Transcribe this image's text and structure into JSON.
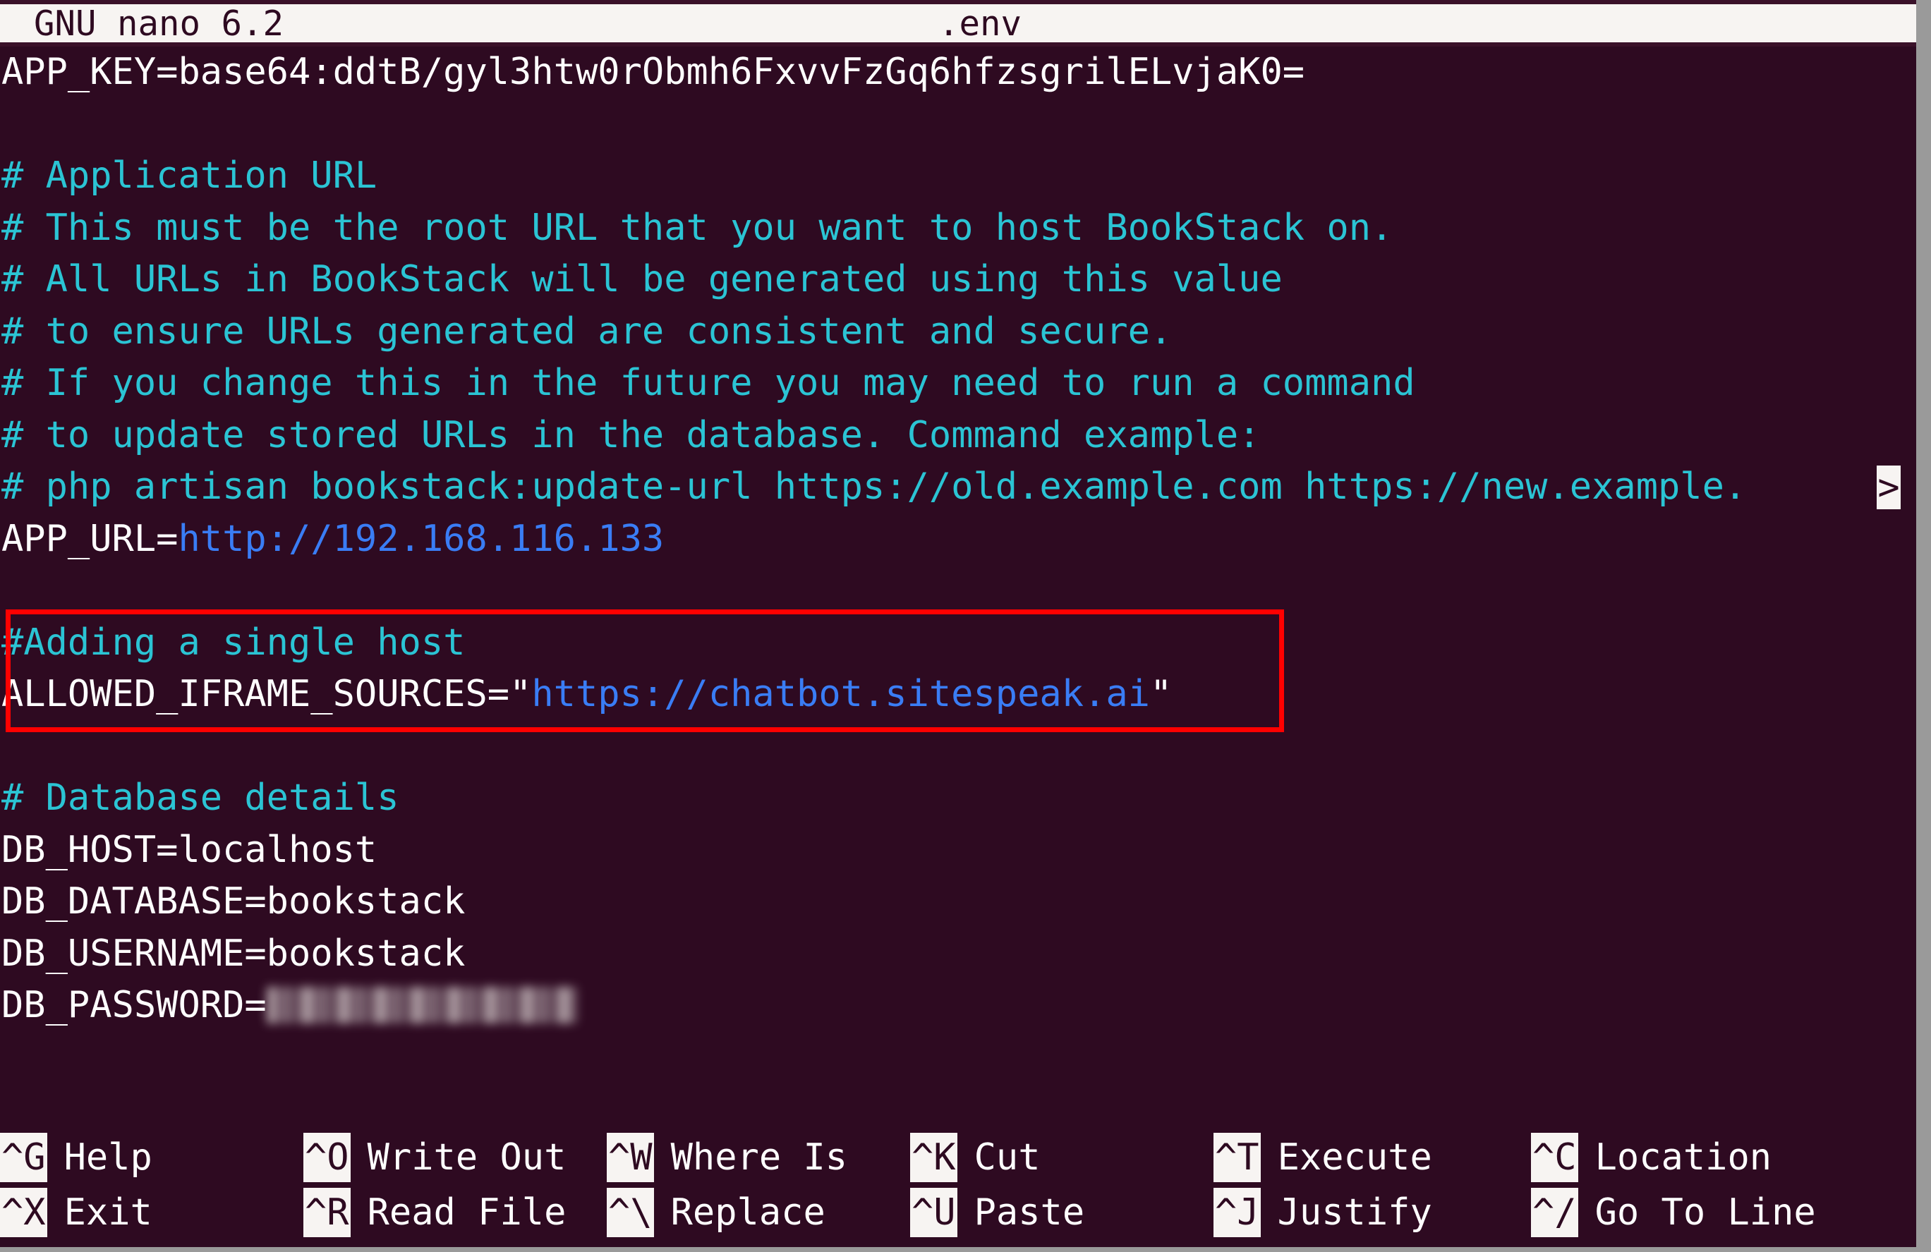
{
  "titlebar": {
    "app": "GNU nano 6.2",
    "filename": ".env"
  },
  "editor": {
    "lines": [
      {
        "id": "app-key",
        "segments": [
          {
            "text": "APP_KEY=base64:ddtB/gyl3htw0rObmh6FxvvFzGq6hfzsgrilELvjaK0=",
            "style": "plain"
          }
        ]
      },
      {
        "id": "blank-1",
        "segments": [
          {
            "text": " ",
            "style": "plain"
          }
        ]
      },
      {
        "id": "comment-app-url",
        "segments": [
          {
            "text": "# Application URL",
            "style": "comment"
          }
        ]
      },
      {
        "id": "comment-root-url",
        "segments": [
          {
            "text": "# This must be the root URL that you want to host BookStack on.",
            "style": "comment"
          }
        ]
      },
      {
        "id": "comment-all-urls",
        "segments": [
          {
            "text": "# All URLs in BookStack will be generated using this value",
            "style": "comment"
          }
        ]
      },
      {
        "id": "comment-ensure",
        "segments": [
          {
            "text": "# to ensure URLs generated are consistent and secure.",
            "style": "comment"
          }
        ]
      },
      {
        "id": "comment-if-change",
        "segments": [
          {
            "text": "# If you change this in the future you may need to run a command",
            "style": "comment"
          }
        ]
      },
      {
        "id": "comment-to-update",
        "segments": [
          {
            "text": "# to update stored URLs in the database. Command example:",
            "style": "comment"
          }
        ]
      },
      {
        "id": "comment-artisan",
        "segments": [
          {
            "text": "# php artisan bookstack:update-url https://old.example.com https://new.example.",
            "style": "comment"
          }
        ],
        "continues": true,
        "continue_marker": ">"
      },
      {
        "id": "app-url",
        "segments": [
          {
            "text": "APP_URL=",
            "style": "plain"
          },
          {
            "text": "http://192.168.116.133",
            "style": "val-blue"
          }
        ]
      },
      {
        "id": "blank-2",
        "segments": [
          {
            "text": " ",
            "style": "plain"
          }
        ]
      },
      {
        "id": "comment-adding-host",
        "segments": [
          {
            "text": "#Adding a single host",
            "style": "comment"
          }
        ]
      },
      {
        "id": "allowed-iframe",
        "segments": [
          {
            "text": "ALLOWED_IFRAME_SOURCES=\"",
            "style": "plain"
          },
          {
            "text": "https://chatbot.sitespeak.ai",
            "style": "val-blue"
          },
          {
            "text": "\"",
            "style": "plain"
          }
        ]
      },
      {
        "id": "blank-3",
        "segments": [
          {
            "text": " ",
            "style": "plain"
          }
        ]
      },
      {
        "id": "comment-db-details",
        "segments": [
          {
            "text": "# Database details",
            "style": "comment"
          }
        ]
      },
      {
        "id": "db-host",
        "segments": [
          {
            "text": "DB_HOST=localhost",
            "style": "plain"
          }
        ]
      },
      {
        "id": "db-database",
        "segments": [
          {
            "text": "DB_DATABASE=bookstack",
            "style": "plain"
          }
        ]
      },
      {
        "id": "db-username",
        "segments": [
          {
            "text": "DB_USERNAME=bookstack",
            "style": "plain"
          }
        ]
      },
      {
        "id": "db-password",
        "segments": [
          {
            "text": "DB_PASSWORD=",
            "style": "plain"
          }
        ],
        "redacted": true
      }
    ]
  },
  "annotation": {
    "highlight_color": "#ff0000",
    "target_line_ids": [
      "comment-adding-host",
      "allowed-iframe"
    ]
  },
  "shortcuts": {
    "row1": [
      {
        "key": "^G",
        "label": "Help"
      },
      {
        "key": "^O",
        "label": "Write Out"
      },
      {
        "key": "^W",
        "label": "Where Is"
      },
      {
        "key": "^K",
        "label": "Cut"
      },
      {
        "key": "^T",
        "label": "Execute"
      },
      {
        "key": "^C",
        "label": "Location"
      }
    ],
    "row2": [
      {
        "key": "^X",
        "label": "Exit"
      },
      {
        "key": "^R",
        "label": "Read File"
      },
      {
        "key": "^\\",
        "label": "Replace"
      },
      {
        "key": "^U",
        "label": "Paste"
      },
      {
        "key": "^J",
        "label": "Justify"
      },
      {
        "key": "^/",
        "label": "Go To Line"
      }
    ]
  },
  "colors": {
    "background": "#2e0a21",
    "comment": "#2bc4d4",
    "value": "#3a7df5",
    "text": "#ffffff",
    "titlebar_bg": "#f7f4f2",
    "highlight": "#ff0000"
  }
}
